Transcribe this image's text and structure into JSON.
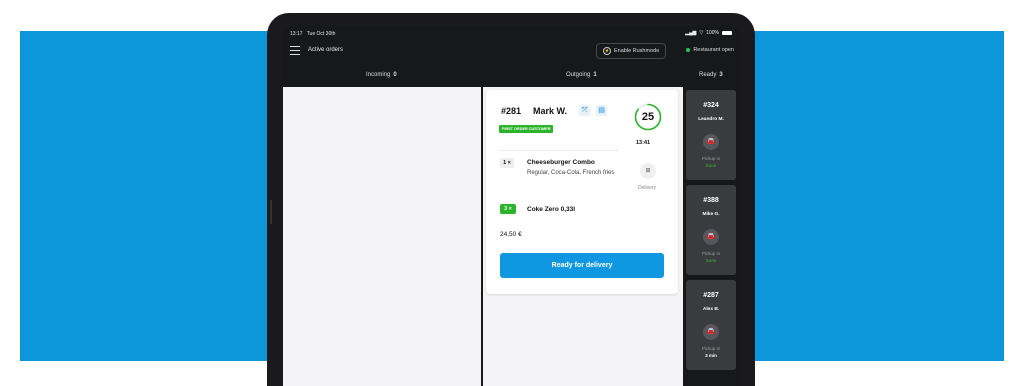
{
  "status_bar": {
    "time": "13:17",
    "date": "Tue Oct 30th",
    "signal": "▂▄▆",
    "wifi": "▽",
    "battery": "100%"
  },
  "app_bar": {
    "title": "Active orders",
    "rush_button": "Enable Rushmode",
    "restaurant_status": "Restaurant open"
  },
  "tabs": [
    {
      "label": "Incoming",
      "count": "0"
    },
    {
      "label": "Outgoing",
      "count": "1"
    },
    {
      "label": "Ready",
      "count": "3"
    }
  ],
  "order": {
    "number": "#281",
    "customer": "Mark W.",
    "badge": "FIRST ORDER CUSTOMER",
    "timer": "25",
    "timer_progress": 0.85,
    "time": "13:41",
    "items": [
      {
        "qty": "1 ×",
        "name": "Cheeseburger Combo",
        "modifiers": "Regular, Coca-Cola, French fries"
      },
      {
        "qty": "3 ×",
        "name": "Coke Zero 0,33l"
      }
    ],
    "delivery_label": "Delivery",
    "total": "24,50 €",
    "action": "Ready for delivery"
  },
  "ready_orders": [
    {
      "number": "#324",
      "name": "Leandro M.",
      "pickup_label": "Pickup in",
      "eta": "Soon"
    },
    {
      "number": "#388",
      "name": "Mike G.",
      "pickup_label": "Pickup in",
      "eta": "Soon"
    },
    {
      "number": "#287",
      "name": "Alex B.",
      "pickup_label": "Pickup in",
      "eta": "3 min"
    }
  ],
  "colors": {
    "page_background": "#0b97d9",
    "accent": "#1097e2",
    "success": "#2cb52c",
    "dark": "#17181a"
  }
}
